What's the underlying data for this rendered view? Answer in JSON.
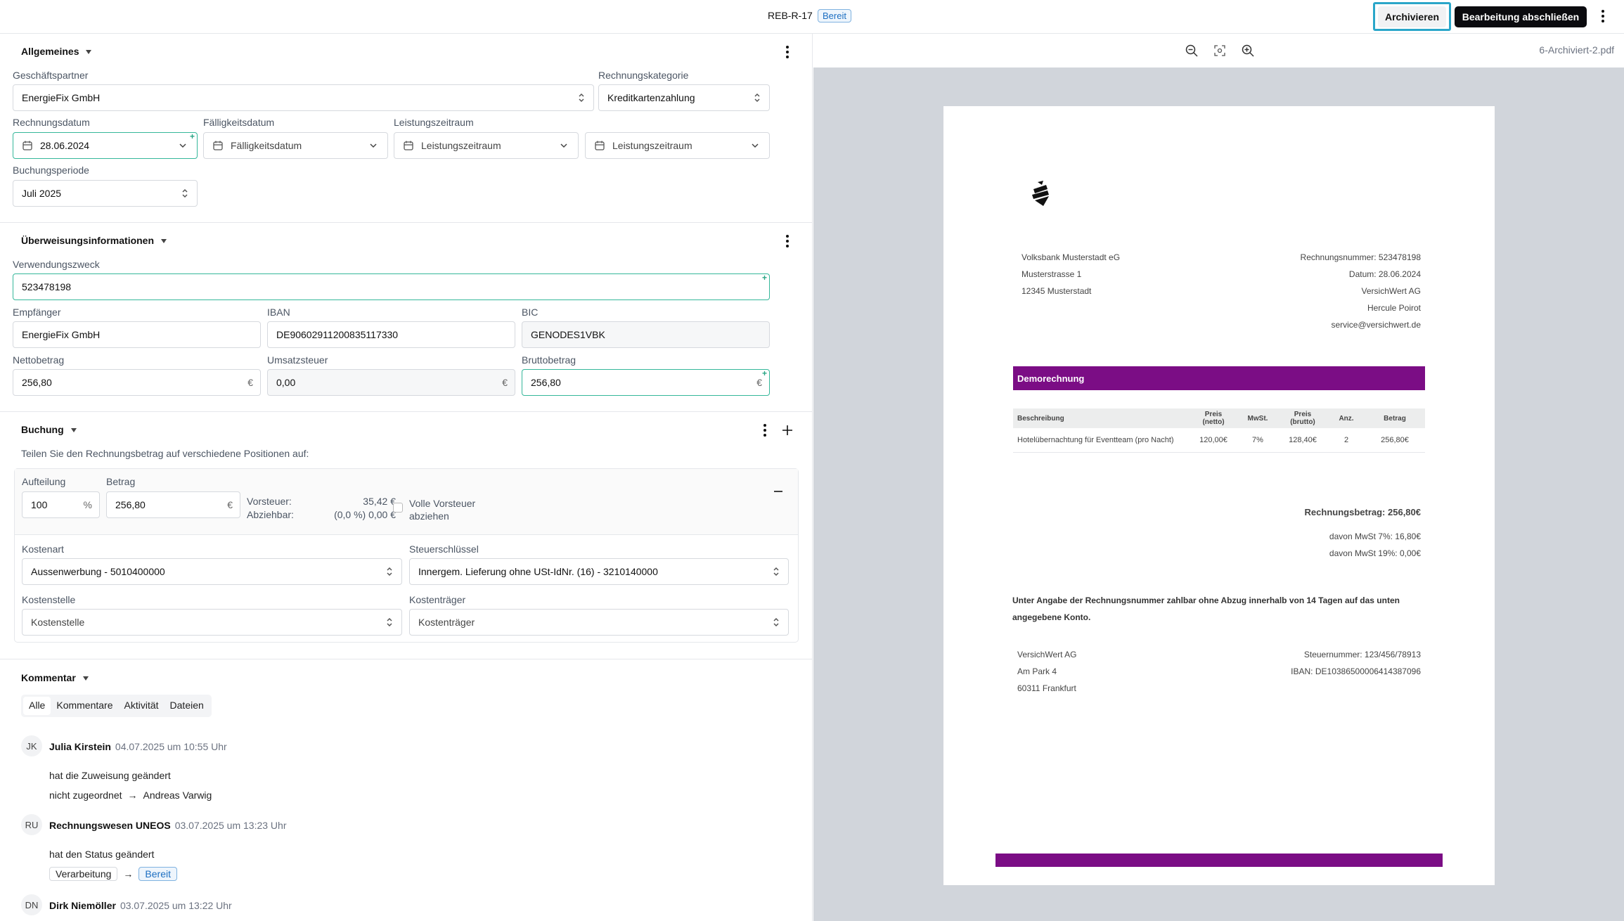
{
  "header": {
    "doc_id": "REB-R-17",
    "status": "Bereit",
    "archive_label": "Archivieren",
    "finish_label": "Bearbeitung abschließen"
  },
  "allgemeines": {
    "title": "Allgemeines",
    "partner_label": "Geschäftspartner",
    "partner_value": "EnergieFix GmbH",
    "category_label": "Rechnungskategorie",
    "category_value": "Kreditkartenzahlung",
    "invoice_date_label": "Rechnungsdatum",
    "invoice_date_value": "28.06.2024",
    "due_date_label": "Fälligkeitsdatum",
    "due_date_placeholder": "Fälligkeitsdatum",
    "service_period_label": "Leistungszeitraum",
    "service_from_placeholder": "Leistungszeitraum",
    "service_to_placeholder": "Leistungszeitraum",
    "booking_period_label": "Buchungsperiode",
    "booking_period_value": "Juli 2025"
  },
  "transfer": {
    "title": "Überweisungsinformationen",
    "purpose_label": "Verwendungszweck",
    "purpose_value": "523478198",
    "recipient_label": "Empfänger",
    "recipient_value": "EnergieFix GmbH",
    "iban_label": "IBAN",
    "iban_value": "DE90602911200835117330",
    "bic_label": "BIC",
    "bic_value": "GENODES1VBK",
    "net_label": "Nettobetrag",
    "net_value": "256,80",
    "vat_label": "Umsatzsteuer",
    "vat_value": "0,00",
    "gross_label": "Bruttobetrag",
    "gross_value": "256,80",
    "currency": "€"
  },
  "buchung": {
    "title": "Buchung",
    "hint": "Teilen Sie den Rechnungsbetrag auf verschiedene Positionen auf:",
    "split_label": "Aufteilung",
    "split_value": "100",
    "split_unit": "%",
    "amount_label": "Betrag",
    "amount_value": "256,80",
    "amount_unit": "€",
    "vorsteuer_label": "Vorsteuer:",
    "vorsteuer_value": "35,42 €",
    "abziehbar_label": "Abziehbar:",
    "abziehbar_value": "(0,0 %) 0,00 €",
    "full_tax_label": "Volle Vorsteuer abziehen",
    "cost_type_label": "Kostenart",
    "cost_type_value": "Aussenwerbung - 5010400000",
    "tax_key_label": "Steuerschlüssel",
    "tax_key_value": "Innergem. Lieferung ohne USt-IdNr. (16) - 3210140000",
    "cost_center_label": "Kostenstelle",
    "cost_center_placeholder": "Kostenstelle",
    "cost_object_label": "Kostenträger",
    "cost_object_placeholder": "Kostenträger"
  },
  "comments": {
    "title": "Kommentar",
    "tabs": [
      "Alle",
      "Kommentare",
      "Aktivität",
      "Dateien"
    ],
    "entries": [
      {
        "initials": "JK",
        "name": "Julia Kirstein",
        "date": "04.07.2025 um 10:55 Uhr",
        "text": "hat die Zuweisung geändert",
        "from": "nicht zugeordnet",
        "to": "Andreas Varwig"
      },
      {
        "initials": "RU",
        "name": "Rechnungswesen UNEOS",
        "date": "03.07.2025 um 13:23 Uhr",
        "text": "hat den Status geändert",
        "from": "Verarbeitung",
        "to": "Bereit"
      },
      {
        "initials": "DN",
        "name": "Dirk Niemöller",
        "date": "03.07.2025 um 13:22 Uhr"
      }
    ]
  },
  "viewer": {
    "file_name": "6-Archiviert-2.pdf"
  },
  "pdf": {
    "sender": [
      "Volksbank Musterstadt eG",
      "Musterstrasse 1",
      "12345 Musterstadt"
    ],
    "meta": [
      "Rechnungsnummer: 523478198",
      "Datum: 28.06.2024",
      "VersichWert AG",
      "Hercule Poirot",
      "service@versichwert.de"
    ],
    "heading": "Demorechnung",
    "columns": [
      "Beschreibung",
      "Preis (netto)",
      "MwSt.",
      "Preis (brutto)",
      "Anz.",
      "Betrag"
    ],
    "rows": [
      [
        "Hotelübernachtung für Eventteam (pro Nacht)",
        "120,00€",
        "7%",
        "128,40€",
        "2",
        "256,80€"
      ]
    ],
    "total": "Rechnungsbetrag: 256,80€",
    "vat_lines": [
      "davon MwSt 7%: 16,80€",
      "davon MwSt 19%: 0,00€"
    ],
    "payment_note": "Unter Angabe der Rechnungsnummer zahlbar ohne Abzug innerhalb von 14 Tagen auf das unten angegebene Konto.",
    "footer_left": [
      "VersichWert AG",
      "Am Park 4",
      "60311 Frankfurt"
    ],
    "footer_right": [
      "Steuernummer: 123/456/78913",
      "IBAN: DE10386500006414387096"
    ]
  },
  "colors": {
    "accent_green": "#35b79a",
    "highlight_blue": "#2aa6c9",
    "pdf_purple": "#7b0d85"
  }
}
